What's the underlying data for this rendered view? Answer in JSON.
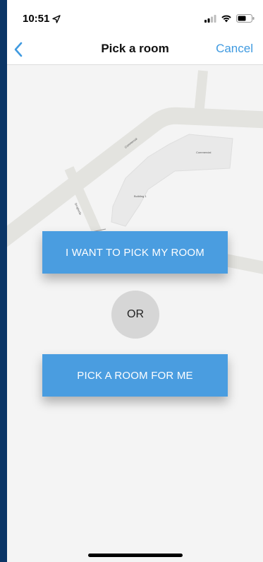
{
  "status_bar": {
    "time": "10:51"
  },
  "nav": {
    "title": "Pick a room",
    "cancel_label": "Cancel"
  },
  "map": {
    "labels": {
      "road_top": "Commercial",
      "road_cross": "Drogheda",
      "building_right": "Commercial",
      "building_center": "Building 1"
    }
  },
  "actions": {
    "pick_my_room_label": "I WANT TO PICK MY ROOM",
    "or_label": "OR",
    "pick_for_me_label": "PICK A ROOM FOR ME"
  },
  "colors": {
    "accent": "#4a9de0",
    "link": "#3f9ae0",
    "background": "#f4f4f4"
  }
}
